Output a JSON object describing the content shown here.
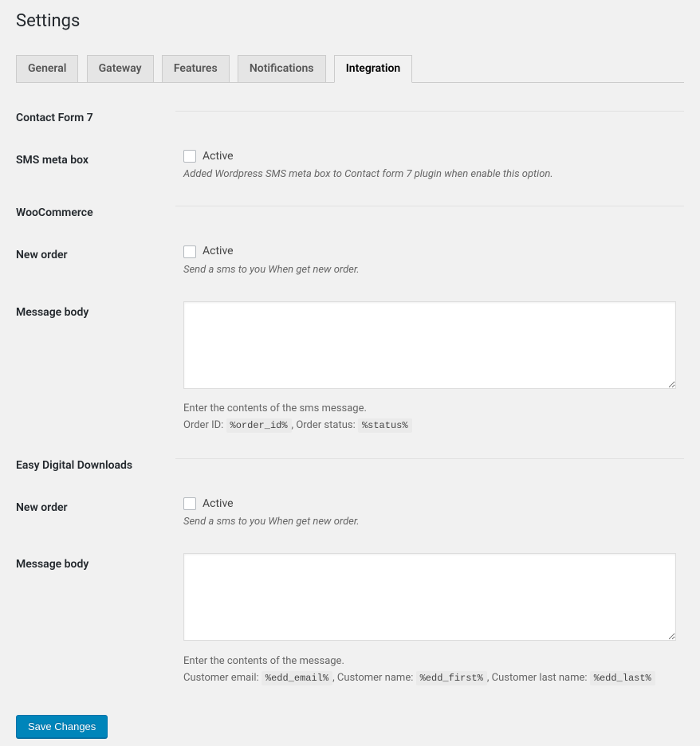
{
  "page": {
    "title": "Settings"
  },
  "tabs": [
    {
      "label": "General"
    },
    {
      "label": "Gateway"
    },
    {
      "label": "Features"
    },
    {
      "label": "Notifications"
    },
    {
      "label": "Integration"
    }
  ],
  "sections": {
    "cf7": {
      "title": "Contact Form 7",
      "sms_meta_box": {
        "label": "SMS meta box",
        "active_label": "Active",
        "description": "Added Wordpress SMS meta box to Contact form 7 plugin when enable this option."
      }
    },
    "woo": {
      "title": "WooCommerce",
      "new_order": {
        "label": "New order",
        "active_label": "Active",
        "description": "Send a sms to you When get new order."
      },
      "message_body": {
        "label": "Message body",
        "value": "",
        "hint_intro": "Enter the contents of the sms message.",
        "order_id_label": "Order ID: ",
        "order_id_code": "%order_id%",
        "order_status_label": ", Order status: ",
        "order_status_code": "%status%"
      }
    },
    "edd": {
      "title": "Easy Digital Downloads",
      "new_order": {
        "label": "New order",
        "active_label": "Active",
        "description": "Send a sms to you When get new order."
      },
      "message_body": {
        "label": "Message body",
        "value": "",
        "hint_intro": "Enter the contents of the message.",
        "email_label": "Customer email: ",
        "email_code": "%edd_email%",
        "name_label": ", Customer name: ",
        "name_code": "%edd_first%",
        "last_label": ", Customer last name: ",
        "last_code": "%edd_last%"
      }
    }
  },
  "submit": {
    "label": "Save Changes"
  }
}
